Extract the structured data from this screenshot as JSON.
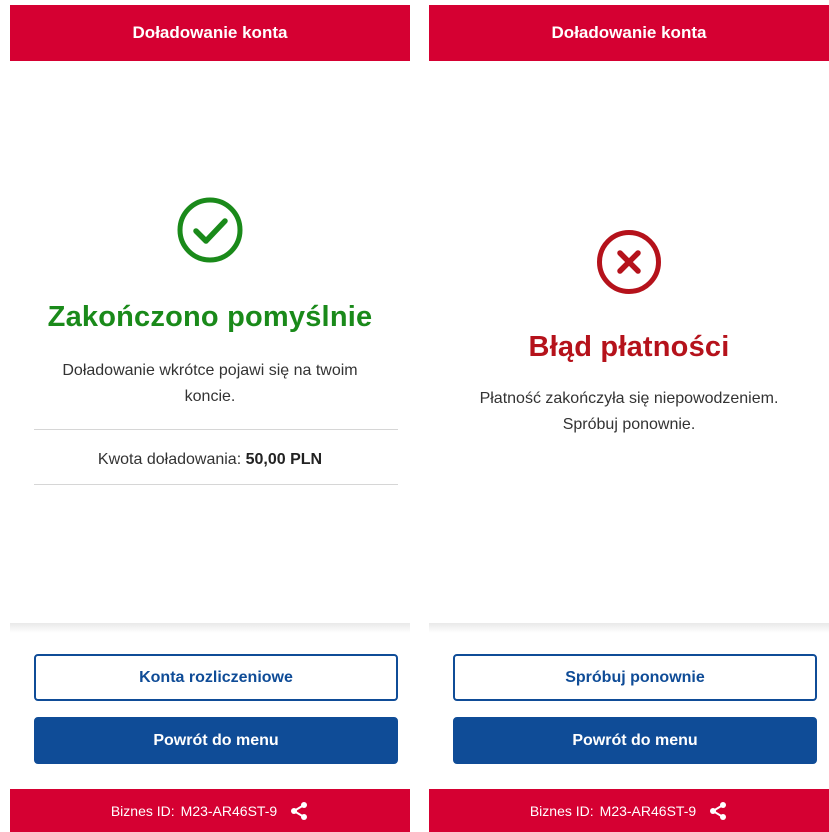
{
  "left_screen": {
    "header_title": "Doładowanie konta",
    "status_title": "Zakończono pomyślnie",
    "description": "Doładowanie wkrótce pojawi się na twoim koncie.",
    "amount_label": "Kwota doładowania:",
    "amount_value": "50,00 PLN",
    "secondary_button": "Konta rozliczeniowe",
    "primary_button": "Powrót do menu",
    "footer_label": "Biznes ID:",
    "footer_id": "M23-AR46ST-9",
    "icon": "check-circle-icon",
    "status_color": "#1a8a1a"
  },
  "right_screen": {
    "header_title": "Doładowanie konta",
    "status_title": "Błąd płatności",
    "description": "Płatność zakończyła się niepowodzeniem. Spróbuj ponownie.",
    "secondary_button": "Spróbuj ponownie",
    "primary_button": "Powrót do menu",
    "footer_label": "Biznes ID:",
    "footer_id": "M23-AR46ST-9",
    "icon": "x-circle-icon",
    "status_color": "#b5121b"
  },
  "colors": {
    "brand_red": "#d50032",
    "primary_blue": "#0f4c97"
  }
}
